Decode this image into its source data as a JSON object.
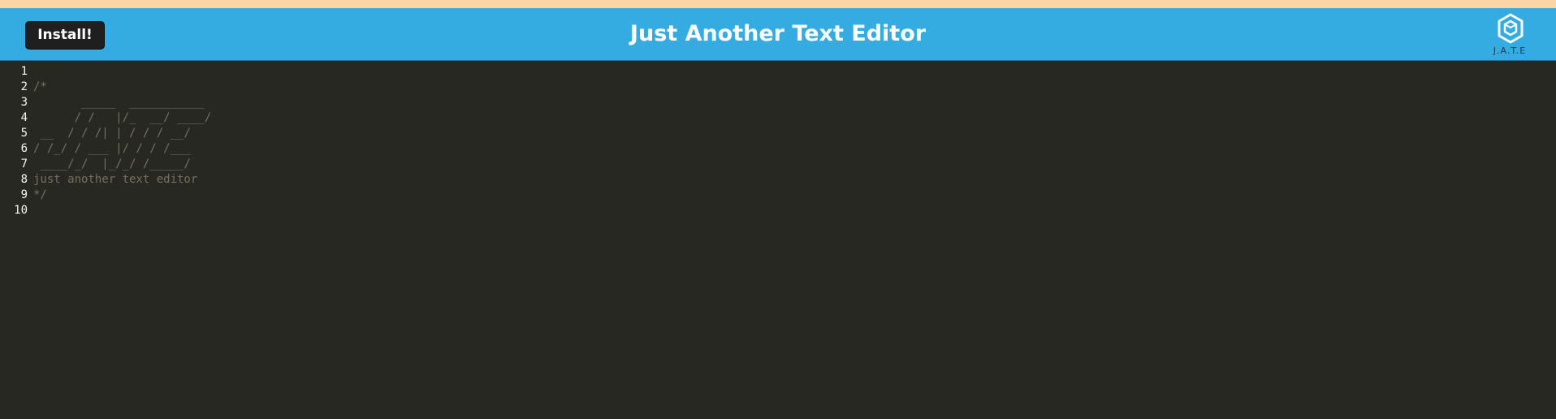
{
  "header": {
    "install_label": "Install!",
    "title": "Just Another Text Editor",
    "logo_text": "J.A.T.E",
    "logo_icon": "hexagon-cube-icon"
  },
  "colors": {
    "navbar": "#34abe1",
    "top_strip": "#fcd5a6",
    "editor_bg": "#272822",
    "comment": "#75715e",
    "line_number": "#f8f8f2"
  },
  "editor": {
    "lines": [
      {
        "num": "1",
        "text": ""
      },
      {
        "num": "2",
        "text": "/*"
      },
      {
        "num": "3",
        "text": "       _____  ___________"
      },
      {
        "num": "4",
        "text": "      / /   |/_  __/ ____/"
      },
      {
        "num": "5",
        "text": " __  / / /| | / / / __/"
      },
      {
        "num": "6",
        "text": "/ /_/ / ___ |/ / / /___"
      },
      {
        "num": "7",
        "text": " ____/_/  |_/_/ /_____/"
      },
      {
        "num": "8",
        "text": "just another text editor"
      },
      {
        "num": "9",
        "text": "*/"
      },
      {
        "num": "10",
        "text": ""
      }
    ]
  }
}
